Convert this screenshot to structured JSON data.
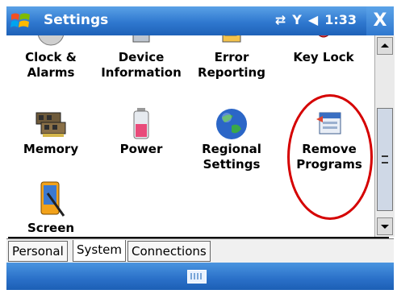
{
  "titlebar": {
    "title": "Settings",
    "time": "1:33",
    "close_label": "X"
  },
  "rows": [
    {
      "items": [
        {
          "label": "Clock & Alarms",
          "line1": "Clock &",
          "line2": "Alarms",
          "icon": "clock-icon"
        },
        {
          "label": "Device Information",
          "line1": "Device",
          "line2": "Information",
          "icon": "device-info-icon"
        },
        {
          "label": "Error Reporting",
          "line1": "Error",
          "line2": "Reporting",
          "icon": "error-reporting-icon"
        },
        {
          "label": "Key Lock",
          "line1": "Key Lock",
          "line2": "",
          "icon": "key-lock-icon"
        }
      ]
    },
    {
      "items": [
        {
          "label": "Memory",
          "line1": "Memory",
          "line2": "",
          "icon": "memory-icon"
        },
        {
          "label": "Power",
          "line1": "Power",
          "line2": "",
          "icon": "battery-icon"
        },
        {
          "label": "Regional Settings",
          "line1": "Regional",
          "line2": "Settings",
          "icon": "globe-icon"
        },
        {
          "label": "Remove Programs",
          "line1": "Remove",
          "line2": "Programs",
          "icon": "remove-programs-icon"
        }
      ]
    },
    {
      "items": [
        {
          "label": "Screen",
          "line1": "Screen",
          "line2": "",
          "icon": "screen-icon"
        }
      ]
    }
  ],
  "tabs": [
    "Personal",
    "System",
    "Connections"
  ],
  "active_tab": "System",
  "colors": {
    "titlebar": "#2f78cf",
    "highlight_circle": "#d50000"
  }
}
